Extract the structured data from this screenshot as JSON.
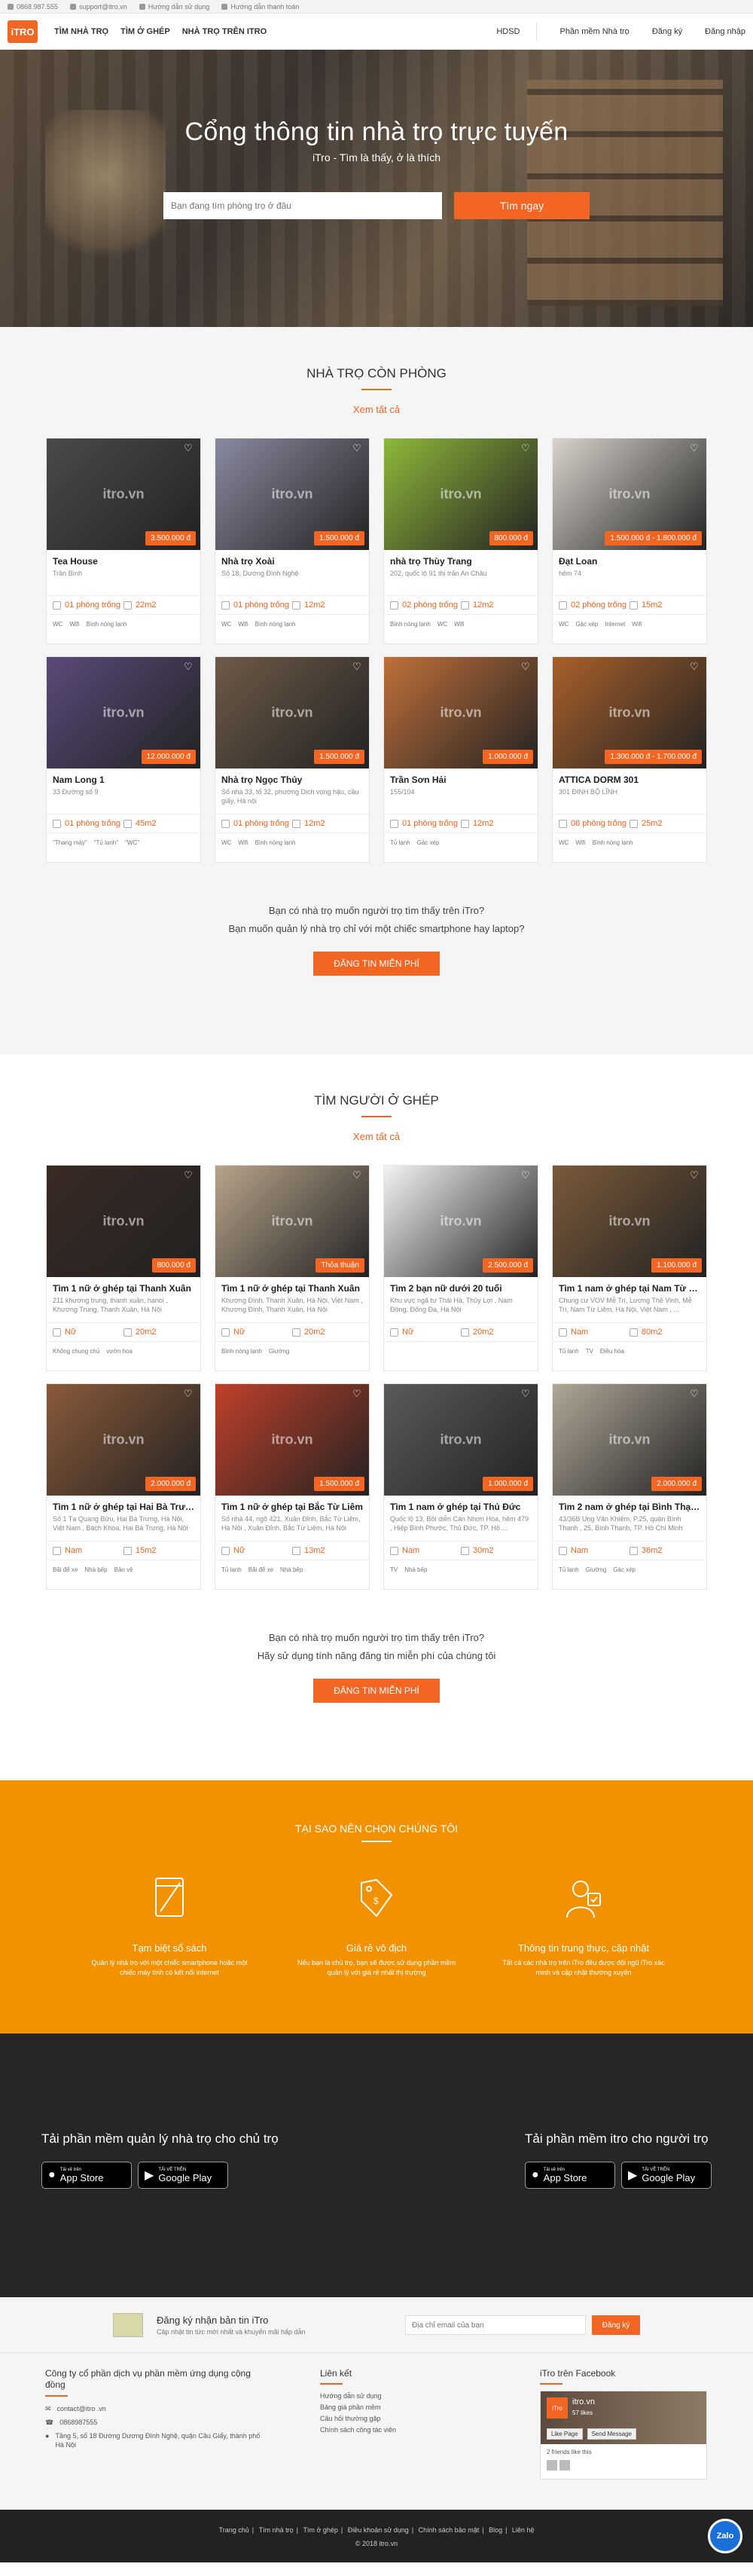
{
  "topbar": {
    "phone": "0868.987.555",
    "email": "support@itro.vn",
    "guide": "Hướng dẫn sử dụng",
    "payment": "Hướng dẫn thanh toán"
  },
  "nav": {
    "logo": "iTRO",
    "links": [
      "TÌM NHÀ TRỌ",
      "TÌM Ở GHÉP",
      "NHÀ TRỌ TRÊN ITRO"
    ],
    "right": [
      "HDSD",
      "Phần mềm Nhà trọ",
      "Đăng ký",
      "Đăng nhập"
    ]
  },
  "hero": {
    "title": "Cổng thông tin nhà trọ trực tuyến",
    "subtitle": "iTro - Tìm là thấy, ở là thích",
    "search_placeholder": "Bạn đang tìm phòng trọ ở đâu",
    "search_button": "Tìm ngay"
  },
  "rooms": {
    "title": "NHÀ TRỌ CÒN PHÒNG",
    "see_all": "Xem tất cả",
    "items": [
      {
        "name": "Tea House",
        "addr": "Trần Bình",
        "price": "3.500.000 đ",
        "rooms": "01 phòng trống",
        "area": "22m2",
        "amen": [
          "WC",
          "Wifi",
          "Bình nóng lạnh"
        ],
        "color": "#4a4a4a"
      },
      {
        "name": "Nhà trọ Xoài",
        "addr": "Số 18, Dương Đình Nghệ",
        "price": "1.500.000 đ",
        "rooms": "01 phòng trống",
        "area": "12m2",
        "amen": [
          "WC",
          "Wifi",
          "Bình nóng lạnh"
        ],
        "color": "#8a8aa0"
      },
      {
        "name": "nhà trọ Thùy Trang",
        "addr": "202, quốc lộ 91 thị trấn An Châu",
        "price": "800.000 đ",
        "rooms": "02 phòng trống",
        "area": "12m2",
        "amen": [
          "Bình nóng lạnh",
          "WC",
          "Wifi"
        ],
        "color": "#8fb83a"
      },
      {
        "name": "Đạt Loan",
        "addr": "hẻm 74",
        "price": "1.500.000 đ - 1.800.000 đ",
        "rooms": "02 phòng trống",
        "area": "15m2",
        "amen": [
          "WC",
          "Gác xép",
          "Internet",
          "Wifi"
        ],
        "color": "#d9d4cc"
      },
      {
        "name": "Nam Long 1",
        "addr": "33 Đường số 9",
        "price": "12.000.000 đ",
        "rooms": "01 phòng trống",
        "area": "45m2",
        "amen": [
          "\"Thang máy\"",
          "\"Tủ lạnh\"",
          "\"WC\""
        ],
        "color": "#5a4a7a"
      },
      {
        "name": "Nhà trọ Ngọc Thủy",
        "addr": "Số nhà 33, tổ 32, phường Dịch vọng hậu, cầu giấy, Hà nội",
        "price": "1.500.000 đ",
        "rooms": "01 phòng trống",
        "area": "12m2",
        "amen": [
          "WC",
          "Wifi",
          "Bình nóng lạnh"
        ],
        "color": "#6e5a48"
      },
      {
        "name": "Trần Sơn Hải",
        "addr": "155/104",
        "price": "1.000.000 đ",
        "rooms": "01 phòng trống",
        "area": "12m2",
        "amen": [
          "Tủ lạnh",
          "Gác xép"
        ],
        "color": "#c0703a"
      },
      {
        "name": "ATTICA DORM 301",
        "addr": "301 ĐINH BỘ LĨNH",
        "price": "1.300.000 đ - 1.700.000 đ",
        "rooms": "08 phòng trống",
        "area": "25m2",
        "amen": [
          "WC",
          "Wifi",
          "Bình nóng lạnh"
        ],
        "color": "#a8602a"
      }
    ],
    "cta_line1": "Bạn có nhà trọ muốn người trọ tìm thấy trên iTro?",
    "cta_line2": "Bạn muốn quản lý nhà trọ chỉ với một chiếc smartphone hay laptop?",
    "cta_button": "ĐĂNG TIN MIỄN PHÍ"
  },
  "roommates": {
    "title": "TÌM NGƯỜI Ở GHÉP",
    "see_all": "Xem tất cả",
    "items": [
      {
        "name": "Tìm 1 nữ ở ghép tại Thanh Xuân",
        "addr": "211 khương trung, thanh xuân, hanoi , Khương Trung, Thanh Xuân, Hà Nội",
        "price": "800.000 đ",
        "gender": "Nữ",
        "area": "20m2",
        "amen": [
          "Không chung chủ",
          "vườn hoa"
        ],
        "color": "#3a2a24"
      },
      {
        "name": "Tìm 1 nữ ở ghép tại Thanh Xuân",
        "addr": "Khương Đình, Thanh Xuân, Hà Nội, Việt Nam , Khương Đình, Thanh Xuân, Hà Nội",
        "price": "Thỏa thuận",
        "gender": "Nữ",
        "area": "20m2",
        "amen": [
          "Bình nóng lạnh",
          "Giường"
        ],
        "color": "#b8a48c"
      },
      {
        "name": "Tìm 2 bạn nữ dưới 20 tuổi",
        "addr": "Khu vực ngã tư Thái Hà, Thủy Lợi , Nam Đồng, Đống Đa, Hà Nội",
        "price": "2.500.000 đ",
        "gender": "Nữ",
        "area": "20m2",
        "amen": [],
        "color": "#f4f4f4"
      },
      {
        "name": "Tìm 1 nam ở ghép tại Nam Từ Liêm",
        "addr": "Chung cư VOV Mễ Trì, Lương Thế Vinh, Mễ Trì, Nam Từ Liêm, Hà Nội, Việt Nam , ...",
        "price": "1.100.000 đ",
        "gender": "Nam",
        "area": "80m2",
        "amen": [
          "Tủ lạnh",
          "TV",
          "Điều hòa"
        ],
        "color": "#7a5a3a"
      },
      {
        "name": "Tìm 1 nữ ở ghép tại Hai Bà Trưng",
        "addr": "Số 1 Tạ Quang Bửu, Hai Bà Trưng, Hà Nội, Việt Nam , Bách Khoa, Hai Bà Trưng, Hà Nội",
        "price": "2.000.000 đ",
        "gender": "Nam",
        "area": "15m2",
        "amen": [
          "Bãi để xe",
          "Nhà bếp",
          "Bảo vệ"
        ],
        "color": "#8a5a3a"
      },
      {
        "name": "Tìm 1 nữ ở ghép tại Bắc Từ Liêm",
        "addr": "Số nhà 44, ngõ 421, Xuân Đỉnh, Bắc Từ Liêm, Hà Nội , Xuân Đỉnh, Bắc Từ Liêm, Hà Nội",
        "price": "1.500.000 đ",
        "gender": "Nữ",
        "area": "13m2",
        "amen": [
          "Tủ lạnh",
          "Bãi để xe",
          "Nhà bếp"
        ],
        "color": "#c0402a"
      },
      {
        "name": "Tìm 1 nam ở ghép tại Thủ Đức",
        "addr": "Quốc lộ 13, Bồi diễn Cán Nhơn Hòa, hẻm 479 , Hiệp Bình Phước, Thủ Đức, TP. Hồ ...",
        "price": "1.000.000 đ",
        "gender": "Nam",
        "area": "30m2",
        "amen": [
          "TV",
          "Nhà bếp"
        ],
        "color": "#5a5a5a"
      },
      {
        "name": "Tìm 2 nam ở ghép tại Bình Thạnh",
        "addr": "43/36B Ung Văn Khiêm, P.25, quận Bình Thạnh , 25, Bình Thạnh, TP. Hồ Chí Minh",
        "price": "2.000.000 đ",
        "gender": "Nam",
        "area": "36m2",
        "amen": [
          "Tủ lạnh",
          "Giường",
          "Gác xép"
        ],
        "color": "#b0a898"
      }
    ],
    "cta_line1": "Bạn có nhà trọ muốn người trọ tìm thấy trên iTro?",
    "cta_line2": "Hãy sử dụng tính năng đăng tin miễn phí của chúng tôi",
    "cta_button": "ĐĂNG TIN MIỄN PHÍ"
  },
  "why": {
    "title": "TẠI SAO NÊN CHỌN CHÚNG TÔI",
    "cols": [
      {
        "title": "Tạm biệt sổ sách",
        "text": "Quản lý nhà trọ với một chiếc smartphone hoặc một chiếc máy tính có kết nối internet",
        "icon": "notebook-icon"
      },
      {
        "title": "Giá rẻ vô địch",
        "text": "Nếu bạn là chủ trọ, bạn sẽ được sử dụng phần mềm quản lý với giá rẻ nhất thị trường",
        "icon": "price-tag-icon"
      },
      {
        "title": "Thông tin trung thực, cập nhật",
        "text": "Tất cả các nhà trọ trên iTro đều được đội ngũ iTro xác minh và cập nhật thường xuyên",
        "icon": "verified-user-icon"
      }
    ]
  },
  "apps": {
    "owner_title": "Tải phần mềm quản lý nhà trọ cho chủ trọ",
    "tenant_title": "Tải phần mềm itro cho người trọ",
    "appstore_small": "Tải về trên",
    "appstore_big": "App Store",
    "google_small": "TẢI VỀ TRÊN",
    "google_big": "Google Play"
  },
  "newsletter": {
    "title": "Đăng ký nhận bản tin iTro",
    "text": "Cập nhật tin tức mới nhất và khuyến mãi hấp dẫn",
    "placeholder": "Địa chỉ email của bạn",
    "button": "Đăng ký"
  },
  "footer": {
    "company": "Công ty cổ phần dịch vụ phần mềm ứng dụng cộng đồng",
    "email": "contact@itro .vn",
    "phone": "0868987555",
    "address": "Tầng 5, số 18 Đường Dương Đình Nghệ, quận Cầu Giấy, thành phố Hà Nội",
    "links_title": "Liên kết",
    "links": [
      "Hướng dẫn sử dụng",
      "Bảng giá phần mềm",
      "Câu hỏi thường gặp",
      "Chính sách công tác viên"
    ],
    "fb_title": "iTro trên Facebook",
    "fb_page": "itro.vn",
    "fb_likes": "57 likes",
    "fb_like_btn": "Like Page",
    "fb_msg_btn": "Send Message",
    "fb_friends": "2 friends like this"
  },
  "bottom": {
    "links": [
      "Trang chủ",
      "Tìm nhà trọ",
      "Tìm ở ghép",
      "Điều khoản sử dụng",
      "Chính sách bảo mật",
      "Blog",
      "Liên hệ"
    ],
    "copyright": "© 2018 itro.vn",
    "zalo": "Zalo"
  },
  "colors": {
    "accent": "#f26522",
    "why_bg": "#f39200",
    "apps_bg": "#262626"
  }
}
